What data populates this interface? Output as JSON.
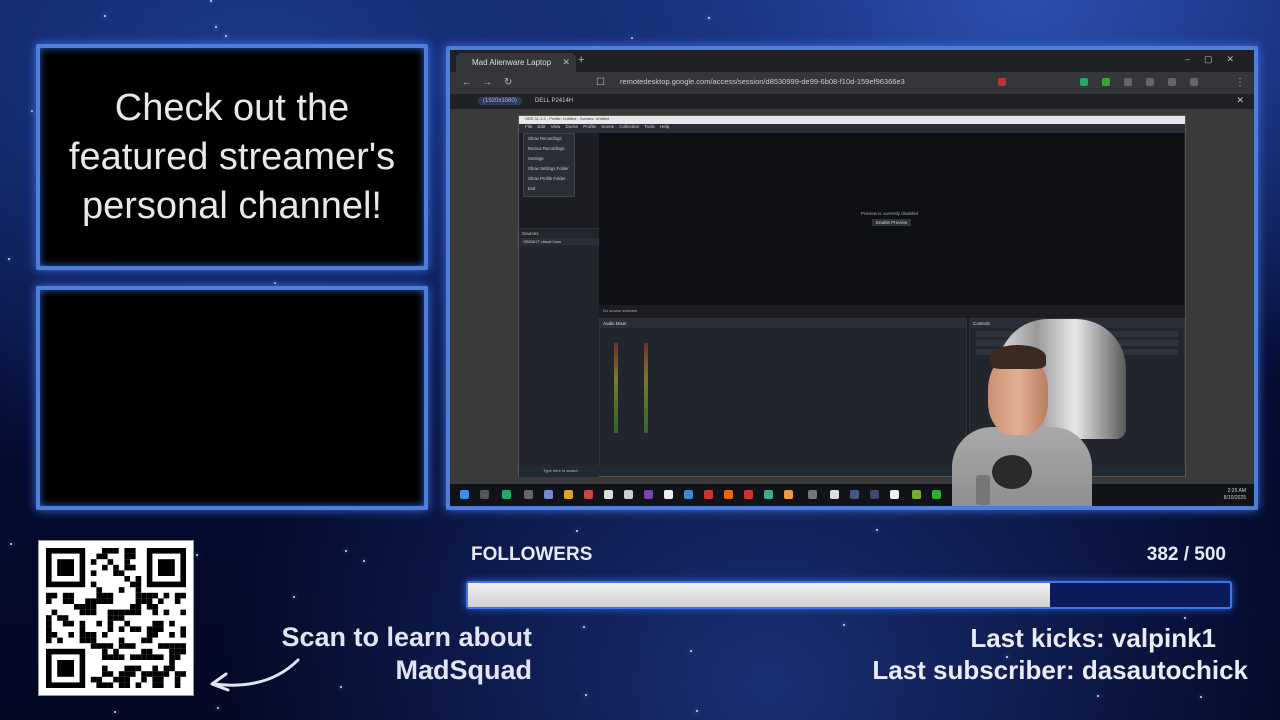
{
  "message_panel": {
    "text": "Check out the featured streamer's personal channel!"
  },
  "browser": {
    "tab_title": "Mad Alienware Laptop",
    "new_tab": "+",
    "address": "remotedesktop.google.com/access/session/d8530999-de99-6b08-f10d-159ef96366e3",
    "remote_tabs": [
      "(1920x1080)",
      "DELL P2414H"
    ]
  },
  "obs": {
    "title": "OBS 31.1.2 - Profile: Untitled - Scenes: Untitled",
    "menu": [
      "File",
      "Edit",
      "View",
      "Docks",
      "Profile",
      "Scene Collection",
      "Tools",
      "Help"
    ],
    "file_menu": [
      "Show Recordings",
      "Remux Recordings",
      "Settings",
      "Show Settings Folder",
      "Show Profile Folder",
      "Exit"
    ],
    "preview_disabled": "Preview is currently disabled",
    "enable_preview": "Enable Preview",
    "sources_header": "Sources",
    "source_item": "OBSBOT virtual Cam",
    "no_source": "No source selected",
    "audio_mixer": "Audio Mixer",
    "controls": "Controls"
  },
  "taskbar": {
    "search_placeholder": "Type here to search",
    "time": "2:25 AM",
    "date": "8/10/2025"
  },
  "qr": {
    "caption": "Scan to learn about MadSquad"
  },
  "followers": {
    "label": "FOLLOWERS",
    "count": "382 / 500",
    "current": 382,
    "goal": 500
  },
  "events": {
    "last_kicks": "Last kicks: valpink1",
    "last_subscriber": "Last subscriber: dasautochick"
  },
  "colors": {
    "frame_border": "#4f7ed8",
    "progress_border": "#3d74e8",
    "background": "#0b1a55"
  }
}
